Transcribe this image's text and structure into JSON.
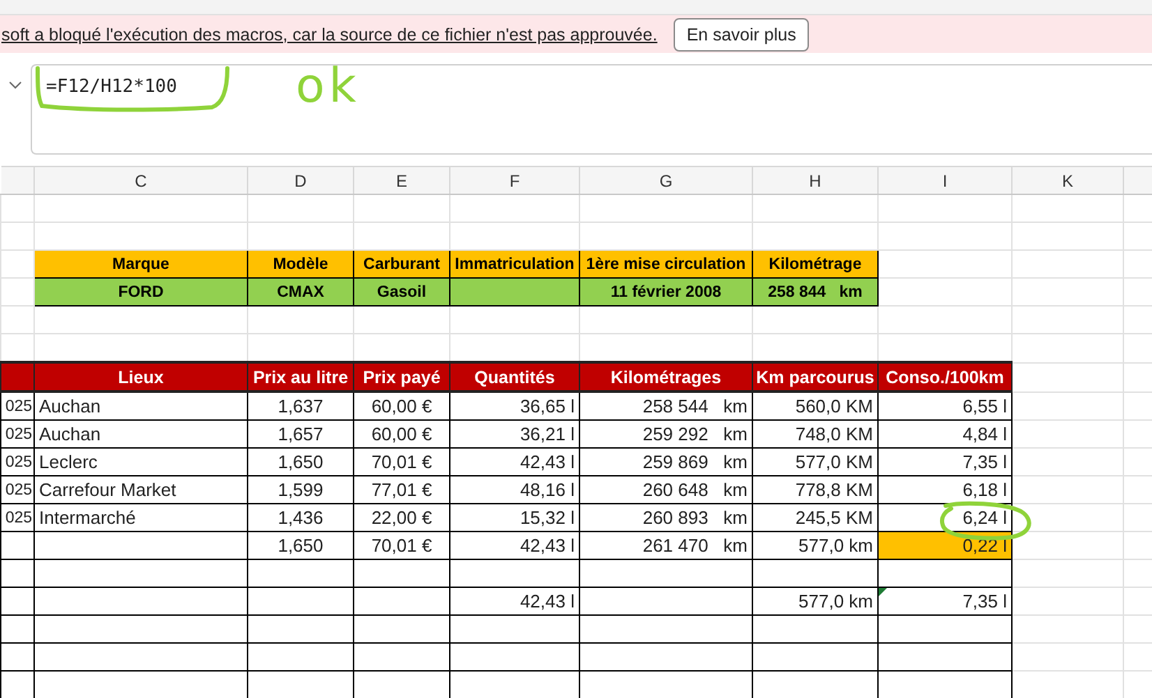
{
  "message_bar": {
    "text": "soft a bloqué l'exécution des macros, car la source de ce fichier n'est pas approuvée.",
    "button": "En savoir plus"
  },
  "formula_bar": {
    "value": "=F12/H12*100"
  },
  "annotation": {
    "text": "ok"
  },
  "column_headers": [
    "C",
    "D",
    "E",
    "F",
    "G",
    "H",
    "I",
    "K"
  ],
  "vehicle_table": {
    "columns": [
      "Marque",
      "Modèle",
      "Carburant",
      "Immatriculation",
      "1ère mise circulation",
      "Kilométrage"
    ],
    "row": {
      "marque": "FORD",
      "modele": "CMAX",
      "carburant": "Gasoil",
      "premiere_mise_circulation": "11 février 2008",
      "kilometrage": "258 844   km"
    }
  },
  "fuel_table": {
    "columns": [
      null,
      "Lieux",
      "Prix au litre",
      "Prix payé",
      "Quantités",
      "Kilométrages",
      "Km parcourus",
      "Conso./100km"
    ],
    "rows": [
      {
        "cells": [
          "025",
          "Auchan",
          "1,637",
          "60,00 €",
          "36,65 l",
          "258 544   km",
          "560,0 KM",
          "6,55 l"
        ],
        "highlighted": false,
        "flagged": false
      },
      {
        "cells": [
          "025",
          "Auchan",
          "1,657",
          "60,00 €",
          "36,21 l",
          "259 292   km",
          "748,0 KM",
          "4,84 l"
        ],
        "highlighted": false,
        "flagged": false
      },
      {
        "cells": [
          "025",
          "Leclerc",
          "1,650",
          "70,01 €",
          "42,43 l",
          "259 869   km",
          "577,0 KM",
          "7,35 l"
        ],
        "highlighted": false,
        "flagged": false
      },
      {
        "cells": [
          "025",
          "Carrefour Market",
          "1,599",
          "77,01 €",
          "48,16 l",
          "260 648   km",
          "778,8 KM",
          "6,18 l"
        ],
        "highlighted": false,
        "flagged": false
      },
      {
        "cells": [
          "025",
          "Intermarché",
          "1,436",
          "22,00 €",
          "15,32 l",
          "260 893   km",
          "245,5 KM",
          "6,24 l"
        ],
        "highlighted": false,
        "flagged": false
      },
      {
        "cells": [
          null,
          null,
          "1,650",
          "70,01 €",
          "42,43 l",
          "261 470   km",
          "577,0 km",
          "0,22 l"
        ],
        "highlighted": true,
        "flagged": false
      },
      {
        "cells": [
          null,
          null,
          null,
          null,
          null,
          null,
          null,
          null
        ],
        "highlighted": false,
        "flagged": false
      },
      {
        "cells": [
          null,
          null,
          null,
          null,
          "42,43 l",
          null,
          "577,0 km",
          "7,35 l"
        ],
        "highlighted": false,
        "flagged": true
      },
      {
        "cells": [
          null,
          null,
          null,
          null,
          null,
          null,
          null,
          null
        ],
        "highlighted": false,
        "flagged": false
      },
      {
        "cells": [
          null,
          null,
          null,
          null,
          null,
          null,
          null,
          null
        ],
        "highlighted": false,
        "flagged": false
      },
      {
        "cells": [
          null,
          null,
          null,
          null,
          null,
          null,
          null,
          null
        ],
        "highlighted": false,
        "flagged": false
      }
    ]
  }
}
